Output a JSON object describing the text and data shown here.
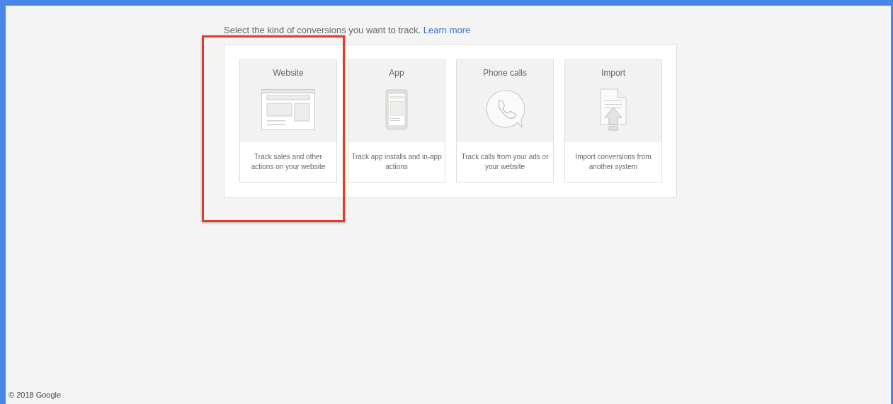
{
  "prompt": {
    "text": "Select the kind of conversions you want to track.",
    "link": "Learn more"
  },
  "options": [
    {
      "kind": "website",
      "title": "Website",
      "description": "Track sales and other actions on your website",
      "highlighted": true
    },
    {
      "kind": "app",
      "title": "App",
      "description": "Track app installs and in-app actions",
      "highlighted": false
    },
    {
      "kind": "phone",
      "title": "Phone calls",
      "description": "Track calls from your ads or your website",
      "highlighted": false
    },
    {
      "kind": "import",
      "title": "Import",
      "description": "Import conversions from another system",
      "highlighted": false
    }
  ],
  "footer": "© 2018 Google"
}
